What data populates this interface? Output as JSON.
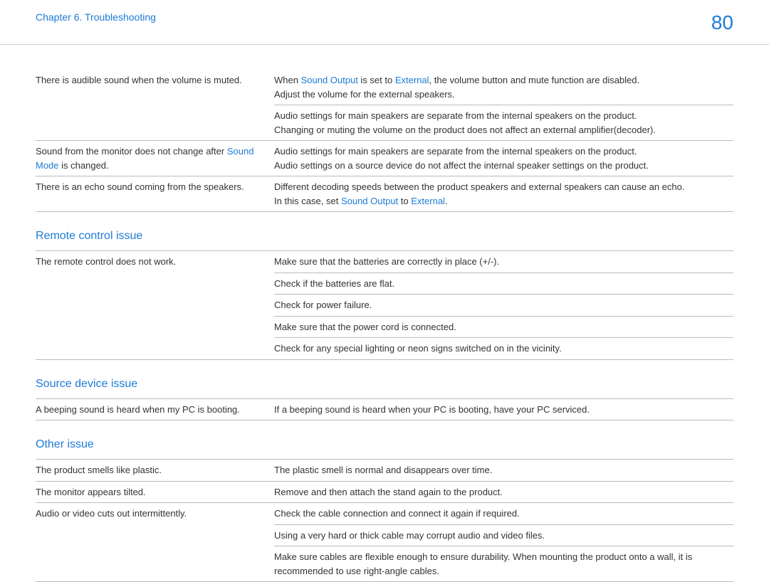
{
  "header": {
    "chapter": "Chapter 6. Troubleshooting",
    "page_number": "80"
  },
  "sections": {
    "sound": {
      "rows": [
        {
          "issue_parts": [
            {
              "t": "There is audible sound when the volume is muted.",
              "h": false
            }
          ],
          "issue_rowspan": 2,
          "sol_parts": [
            {
              "t": "When ",
              "h": false
            },
            {
              "t": "Sound Output",
              "h": true
            },
            {
              "t": " is set to ",
              "h": false
            },
            {
              "t": "External",
              "h": true
            },
            {
              "t": ", the volume button and mute function are disabled.",
              "h": false
            },
            {
              "t": "\n",
              "h": false
            },
            {
              "t": "Adjust the volume for the external speakers.",
              "h": false
            }
          ]
        },
        {
          "sol_parts": [
            {
              "t": "Audio settings for main speakers are separate from the internal speakers on the product.",
              "h": false
            },
            {
              "t": "\n",
              "h": false
            },
            {
              "t": "Changing or muting the volume on the product does not affect an external amplifier(decoder).",
              "h": false
            }
          ]
        },
        {
          "issue_parts": [
            {
              "t": "Sound from the monitor does not change after ",
              "h": false
            },
            {
              "t": "Sound Mode",
              "h": true
            },
            {
              "t": " is changed.",
              "h": false
            }
          ],
          "sol_parts": [
            {
              "t": "Audio settings for main speakers are separate from the internal speakers on the product.",
              "h": false
            },
            {
              "t": "\n",
              "h": false
            },
            {
              "t": "Audio settings on a source device do not affect the internal speaker settings on the product.",
              "h": false
            }
          ]
        },
        {
          "issue_parts": [
            {
              "t": "There is an echo sound coming from the speakers.",
              "h": false
            }
          ],
          "sol_parts": [
            {
              "t": "Different decoding speeds between the product speakers and external speakers can cause an echo.",
              "h": false
            },
            {
              "t": "\n",
              "h": false
            },
            {
              "t": "In this case, set ",
              "h": false
            },
            {
              "t": "Sound Output",
              "h": true
            },
            {
              "t": " to ",
              "h": false
            },
            {
              "t": "External",
              "h": true
            },
            {
              "t": ".",
              "h": false
            }
          ]
        }
      ]
    },
    "remote": {
      "heading": "Remote control issue",
      "rows": [
        {
          "issue_parts": [
            {
              "t": "The remote control does not work.",
              "h": false
            }
          ],
          "issue_rowspan": 5,
          "sol_parts": [
            {
              "t": "Make sure that the batteries are correctly in place (+/-).",
              "h": false
            }
          ]
        },
        {
          "sol_parts": [
            {
              "t": "Check if the batteries are flat.",
              "h": false
            }
          ]
        },
        {
          "sol_parts": [
            {
              "t": "Check for power failure.",
              "h": false
            }
          ]
        },
        {
          "sol_parts": [
            {
              "t": "Make sure that the power cord is connected.",
              "h": false
            }
          ]
        },
        {
          "sol_parts": [
            {
              "t": "Check for any special lighting or neon signs switched on in the vicinity.",
              "h": false
            }
          ]
        }
      ]
    },
    "source": {
      "heading": "Source device issue",
      "rows": [
        {
          "issue_parts": [
            {
              "t": "A beeping sound is heard when my PC is booting.",
              "h": false
            }
          ],
          "sol_parts": [
            {
              "t": "If a beeping sound is heard when your PC is booting, have your PC serviced.",
              "h": false
            }
          ]
        }
      ]
    },
    "other": {
      "heading": "Other issue",
      "rows": [
        {
          "issue_parts": [
            {
              "t": "The product smells like plastic.",
              "h": false
            }
          ],
          "sol_parts": [
            {
              "t": "The plastic smell is normal and disappears over time.",
              "h": false
            }
          ]
        },
        {
          "issue_parts": [
            {
              "t": "The monitor appears tilted.",
              "h": false
            }
          ],
          "sol_parts": [
            {
              "t": "Remove and then attach the stand again to the product.",
              "h": false
            }
          ]
        },
        {
          "issue_parts": [
            {
              "t": "Audio or video cuts out intermittently.",
              "h": false
            }
          ],
          "issue_rowspan": 3,
          "sol_parts": [
            {
              "t": "Check the cable connection and connect it again if required.",
              "h": false
            }
          ]
        },
        {
          "sol_parts": [
            {
              "t": "Using a very hard or thick cable may corrupt audio and video files.",
              "h": false
            }
          ]
        },
        {
          "sol_parts": [
            {
              "t": "Make sure cables are flexible enough to ensure durability. When mounting the product onto a wall, it is recommended to use right-angle cables.",
              "h": false
            }
          ]
        }
      ]
    }
  }
}
